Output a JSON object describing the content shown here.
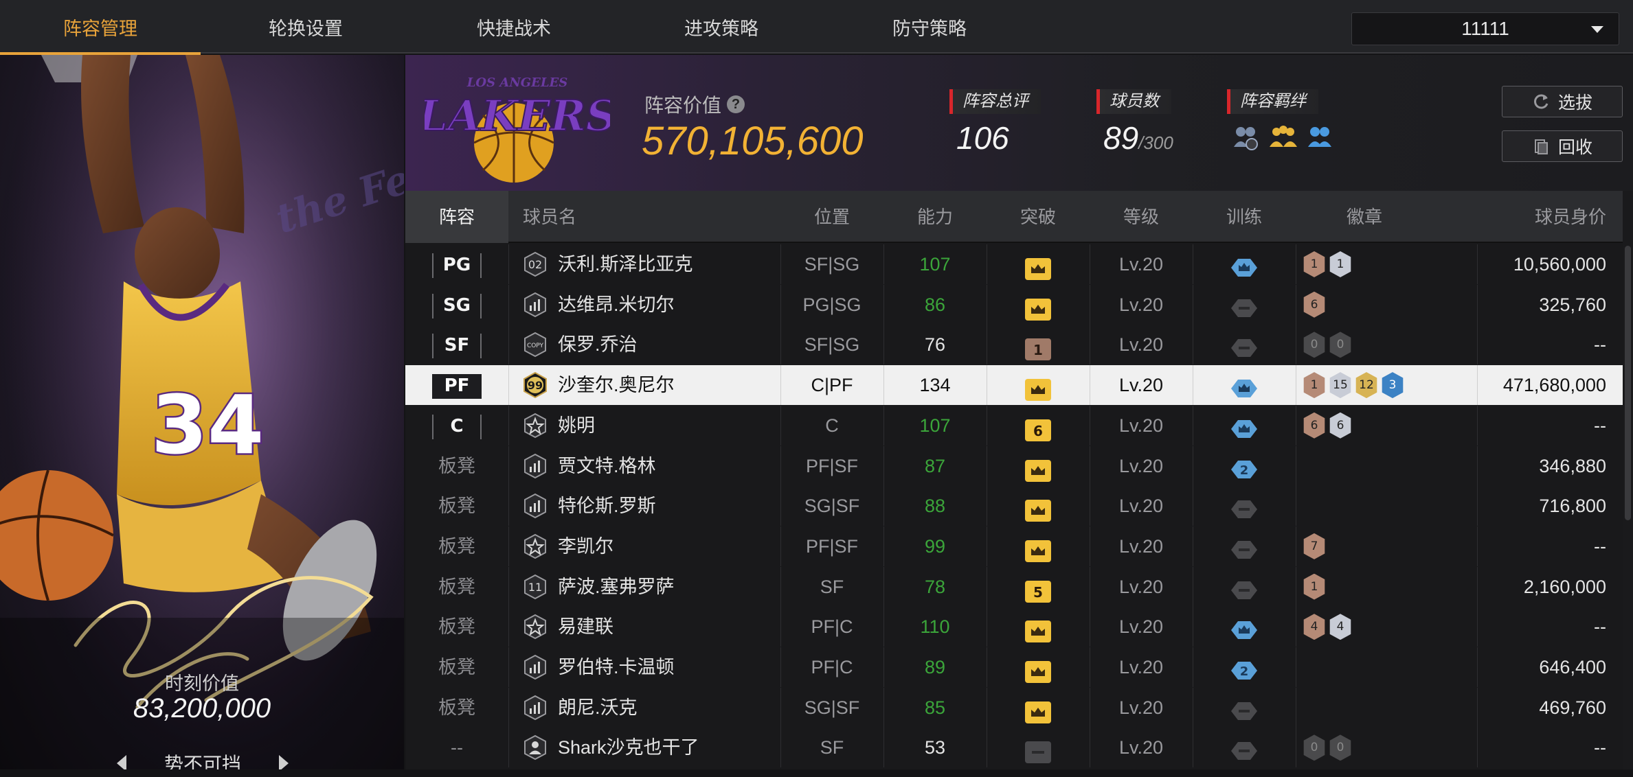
{
  "tabs": [
    {
      "label": "阵容管理",
      "active": true
    },
    {
      "label": "轮换设置",
      "active": false
    },
    {
      "label": "快捷战术",
      "active": false
    },
    {
      "label": "进攻策略",
      "active": false
    },
    {
      "label": "防守策略",
      "active": false
    }
  ],
  "lineup_selector": {
    "value": "11111"
  },
  "hero": {
    "moment_label": "时刻价值",
    "moment_value": "83,200,000",
    "jersey": "34",
    "card_name": "势不可挡"
  },
  "team": {
    "logo_text": "LAKERS",
    "logo_subtext": "LOS ANGELES",
    "value_label": "阵容价值",
    "value": "570,105,600",
    "overall_label": "阵容总评",
    "overall": "106",
    "players_label": "球员数",
    "players": "89",
    "players_max": "/300",
    "bond_label": "阵容羁绊"
  },
  "buttons": {
    "select": "选拔",
    "recycle": "回收"
  },
  "columns": [
    "阵容",
    "球员名",
    "位置",
    "能力",
    "突破",
    "等级",
    "训练",
    "徽章",
    "球员身价"
  ],
  "rows": [
    {
      "slot": "PG",
      "starter": true,
      "grade": "02",
      "name": "沃利.斯泽比亚克",
      "position": "SF|SG",
      "ability": "107",
      "ability_color": "green",
      "breakthrough": "crown",
      "level": "Lv.20",
      "train": "crown",
      "badges": [
        [
          "bronze",
          "1"
        ],
        [
          "silver",
          "1"
        ]
      ],
      "price": "10,560,000"
    },
    {
      "slot": "SG",
      "starter": true,
      "grade": "bars",
      "name": "达维昂.米切尔",
      "position": "PG|SG",
      "ability": "86",
      "ability_color": "green",
      "breakthrough": "crown",
      "level": "Lv.20",
      "train": "none",
      "badges": [
        [
          "bronze",
          "6"
        ]
      ],
      "price": "325,760"
    },
    {
      "slot": "SF",
      "starter": true,
      "grade": "COPY",
      "name": "保罗.乔治",
      "position": "SF|SG",
      "ability": "76",
      "ability_color": "white",
      "breakthrough": "1",
      "level": "Lv.20",
      "train": "none",
      "badges": [
        [
          "dark",
          "0"
        ],
        [
          "dark",
          "0"
        ]
      ],
      "price": "--"
    },
    {
      "slot": "PF",
      "starter": true,
      "selected": true,
      "grade": "99",
      "name": "沙奎尔.奥尼尔",
      "position": "C|PF",
      "ability": "134",
      "ability_color": "white",
      "breakthrough": "crown",
      "level": "Lv.20",
      "train": "crown",
      "badges": [
        [
          "bronze",
          "1"
        ],
        [
          "silver",
          "15"
        ],
        [
          "gold",
          "12"
        ],
        [
          "blue",
          "3"
        ]
      ],
      "price": "471,680,000"
    },
    {
      "slot": "C",
      "starter": true,
      "grade": "star",
      "name": "姚明",
      "position": "C",
      "ability": "107",
      "ability_color": "green",
      "breakthrough": "6",
      "level": "Lv.20",
      "train": "crown",
      "badges": [
        [
          "bronze",
          "6"
        ],
        [
          "silver",
          "6"
        ]
      ],
      "price": "--"
    },
    {
      "slot": "板凳",
      "starter": false,
      "grade": "bars",
      "name": "贾文特.格林",
      "position": "PF|SF",
      "ability": "87",
      "ability_color": "green",
      "breakthrough": "crown",
      "level": "Lv.20",
      "train": "2",
      "badges": [],
      "price": "346,880"
    },
    {
      "slot": "板凳",
      "starter": false,
      "grade": "bars",
      "name": "特伦斯.罗斯",
      "position": "SG|SF",
      "ability": "88",
      "ability_color": "green",
      "breakthrough": "crown",
      "level": "Lv.20",
      "train": "none",
      "badges": [],
      "price": "716,800"
    },
    {
      "slot": "板凳",
      "starter": false,
      "grade": "star",
      "name": "李凯尔",
      "position": "PF|SF",
      "ability": "99",
      "ability_color": "green",
      "breakthrough": "crown",
      "level": "Lv.20",
      "train": "none",
      "badges": [
        [
          "bronze",
          "7"
        ]
      ],
      "price": "--"
    },
    {
      "slot": "板凳",
      "starter": false,
      "grade": "11",
      "name": "萨波.塞弗罗萨",
      "position": "SF",
      "ability": "78",
      "ability_color": "green",
      "breakthrough": "5",
      "level": "Lv.20",
      "train": "none",
      "badges": [
        [
          "bronze",
          "1"
        ]
      ],
      "price": "2,160,000"
    },
    {
      "slot": "板凳",
      "starter": false,
      "grade": "star",
      "name": "易建联",
      "position": "PF|C",
      "ability": "110",
      "ability_color": "green",
      "breakthrough": "crown",
      "level": "Lv.20",
      "train": "crown",
      "badges": [
        [
          "bronze",
          "4"
        ],
        [
          "silver",
          "4"
        ]
      ],
      "price": "--"
    },
    {
      "slot": "板凳",
      "starter": false,
      "grade": "bars",
      "name": "罗伯特.卡温顿",
      "position": "PF|C",
      "ability": "89",
      "ability_color": "green",
      "breakthrough": "crown",
      "level": "Lv.20",
      "train": "2",
      "badges": [],
      "price": "646,400"
    },
    {
      "slot": "板凳",
      "starter": false,
      "grade": "bars",
      "name": "朗尼.沃克",
      "position": "SG|SF",
      "ability": "85",
      "ability_color": "green",
      "breakthrough": "crown",
      "level": "Lv.20",
      "train": "none",
      "badges": [],
      "price": "469,760"
    },
    {
      "slot": "--",
      "starter": false,
      "grade": "person",
      "name": "Shark沙克也干了",
      "position": "SF",
      "ability": "53",
      "ability_color": "white",
      "breakthrough": "none",
      "level": "Lv.20",
      "train": "none",
      "badges": [
        [
          "dark",
          "0"
        ],
        [
          "dark",
          "0"
        ]
      ],
      "price": "--"
    }
  ],
  "colors": {
    "accent": "#e8a33a",
    "value_gold": "#f2b234",
    "green": "#3ba53a",
    "stat_red": "#d8262b",
    "crown_yellow": "#f2c23a",
    "train_blue": "#5aa0d8"
  }
}
